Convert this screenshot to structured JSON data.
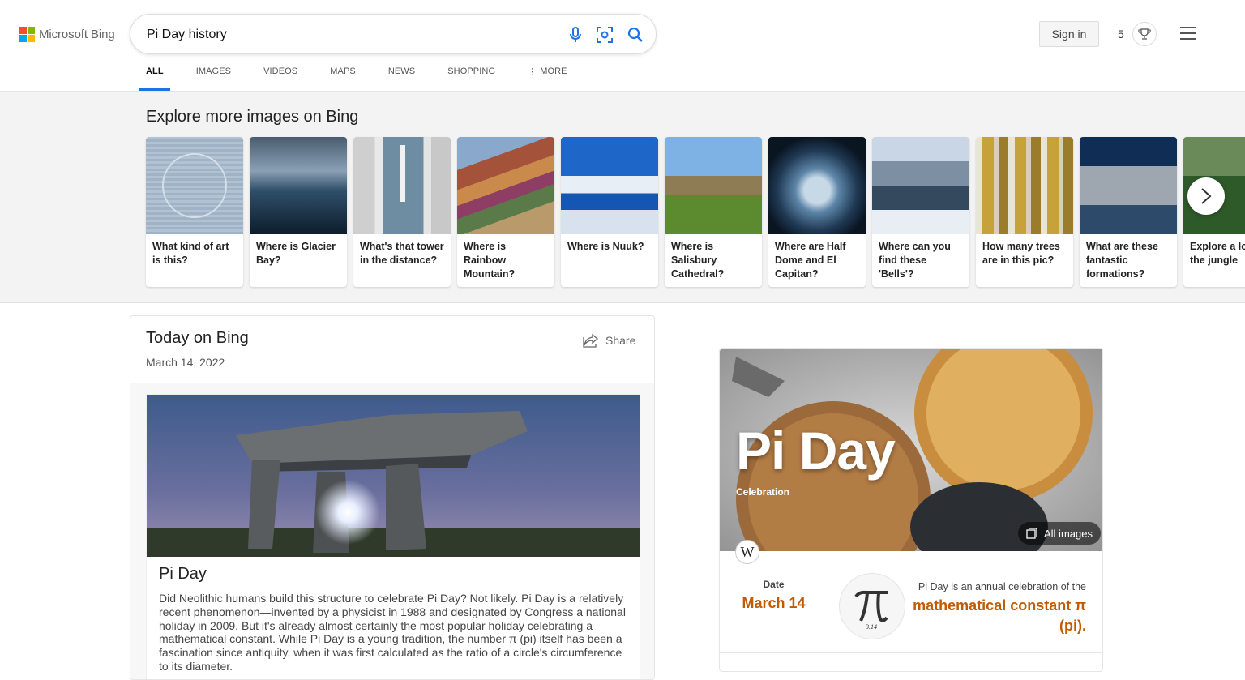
{
  "brand": {
    "logo_text": "Microsoft Bing",
    "colors": {
      "red": "#f25022",
      "green": "#7fba00",
      "blue": "#00a4ef",
      "yellow": "#ffb900"
    }
  },
  "search": {
    "query": "Pi Day history",
    "placeholder": ""
  },
  "header": {
    "signin": "Sign in",
    "rewards_count": "5"
  },
  "tabs": [
    {
      "label": "ALL",
      "active": true
    },
    {
      "label": "IMAGES"
    },
    {
      "label": "VIDEOS"
    },
    {
      "label": "MAPS"
    },
    {
      "label": "NEWS"
    },
    {
      "label": "SHOPPING"
    },
    {
      "label": "MORE"
    }
  ],
  "explore": {
    "title": "Explore more images on Bing",
    "cards": [
      {
        "label": "What kind of art is this?"
      },
      {
        "label": "Where is Glacier Bay?"
      },
      {
        "label": "What's that tower in the distance?"
      },
      {
        "label": "Where is Rainbow Mountain?"
      },
      {
        "label": "Where is Nuuk?"
      },
      {
        "label": "Where is Salisbury Cathedral?"
      },
      {
        "label": "Where are Half Dome and El Capitan?"
      },
      {
        "label": "Where can you find these 'Bells'?"
      },
      {
        "label": "How many trees are in this pic?"
      },
      {
        "label": "What are these fantastic formations?"
      },
      {
        "label": "Explore a lo in the jungle"
      }
    ]
  },
  "today": {
    "title": "Today on Bing",
    "date": "March 14, 2022",
    "share": "Share",
    "card_title": "Pi Day",
    "card_desc": "Did Neolithic humans build this structure to celebrate Pi Day? Not likely. Pi Day is a relatively recent phenomenon—invented by a physicist in 1988 and designated by Congress a national holiday in 2009. But it's already almost certainly the most popular holiday celebrating a mathematical constant. While Pi Day is a young tradition, the number π (pi) itself has been a fascination since antiquity, when it was first calculated as the ratio of a circle's circumference to its diameter."
  },
  "entity": {
    "title": "Pi Day",
    "subtitle": "Celebration",
    "all_images": "All images",
    "wiki_letter": "W",
    "date_label": "Date",
    "date_value": "March 14",
    "pi_caption": "3.14",
    "desc_small": "Pi Day is an annual celebration of the",
    "desc_big": "mathematical constant π (pi)."
  }
}
